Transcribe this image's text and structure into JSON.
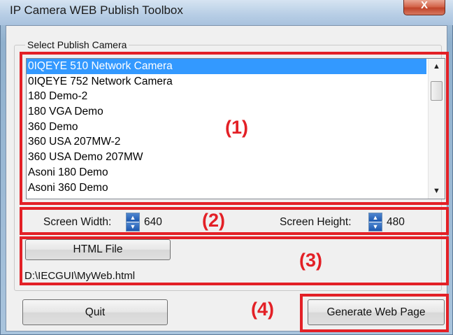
{
  "window": {
    "title": "IP Camera WEB Publish Toolbox",
    "close_glyph": "X"
  },
  "group": {
    "legend": "Select Publish Camera"
  },
  "camera_list": {
    "selected_index": 0,
    "items": [
      "0IQEYE 510 Network Camera",
      "0IQEYE 752 Network Camera",
      "180 Demo-2",
      "180 VGA Demo",
      "360 Demo",
      "360 USA 207MW-2",
      "360 USA Demo 207MW",
      "Asoni 180 Demo",
      "Asoni 360 Demo"
    ]
  },
  "screen": {
    "width_label": "Screen Width:",
    "width_value": "640",
    "height_label": "Screen Height:",
    "height_value": "480"
  },
  "html_file": {
    "button_label": "HTML File",
    "path": "D:\\IECGUI\\MyWeb.html"
  },
  "actions": {
    "quit_label": "Quit",
    "generate_label": "Generate Web Page"
  },
  "annotations": {
    "a1": "(1)",
    "a2": "(2)",
    "a3": "(3)",
    "a4": "(4)"
  },
  "colors": {
    "annotation_red": "#e32026",
    "selection_blue": "#3399ff"
  },
  "icons": {
    "close": "close-icon",
    "scroll_up": "scroll-up-arrow-icon",
    "scroll_down": "scroll-down-arrow-icon",
    "spin_up": "spin-up-icon",
    "spin_down": "spin-down-icon"
  }
}
